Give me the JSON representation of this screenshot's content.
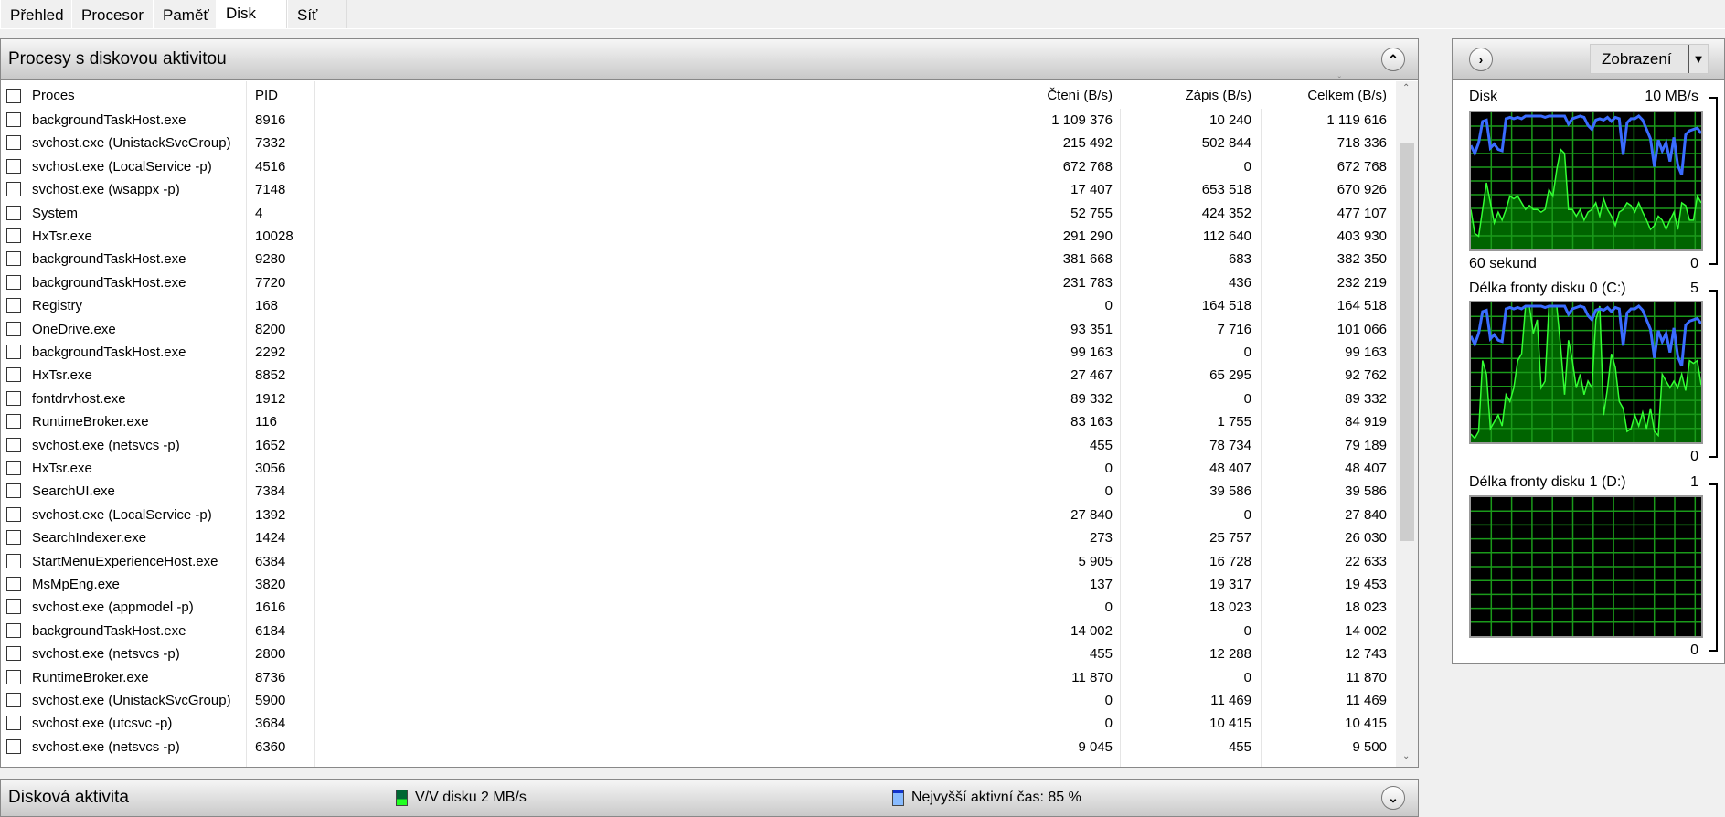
{
  "tabs": [
    "Přehled",
    "Procesor",
    "Paměť",
    "Disk",
    "Síť"
  ],
  "active_tab": "Disk",
  "processes_section": {
    "title": "Procesy s diskovou aktivitou",
    "columns": {
      "name": "Proces",
      "pid": "PID",
      "read": "Čtení (B/s)",
      "write": "Zápis (B/s)",
      "total": "Celkem (B/s)"
    },
    "rows": [
      [
        "backgroundTaskHost.exe",
        "8916",
        "1 109 376",
        "10 240",
        "1 119 616"
      ],
      [
        "svchost.exe (UnistackSvcGroup)",
        "7332",
        "215 492",
        "502 844",
        "718 336"
      ],
      [
        "svchost.exe (LocalService -p)",
        "4516",
        "672 768",
        "0",
        "672 768"
      ],
      [
        "svchost.exe (wsappx -p)",
        "7148",
        "17 407",
        "653 518",
        "670 926"
      ],
      [
        "System",
        "4",
        "52 755",
        "424 352",
        "477 107"
      ],
      [
        "HxTsr.exe",
        "10028",
        "291 290",
        "112 640",
        "403 930"
      ],
      [
        "backgroundTaskHost.exe",
        "9280",
        "381 668",
        "683",
        "382 350"
      ],
      [
        "backgroundTaskHost.exe",
        "7720",
        "231 783",
        "436",
        "232 219"
      ],
      [
        "Registry",
        "168",
        "0",
        "164 518",
        "164 518"
      ],
      [
        "OneDrive.exe",
        "8200",
        "93 351",
        "7 716",
        "101 066"
      ],
      [
        "backgroundTaskHost.exe",
        "2292",
        "99 163",
        "0",
        "99 163"
      ],
      [
        "HxTsr.exe",
        "8852",
        "27 467",
        "65 295",
        "92 762"
      ],
      [
        "fontdrvhost.exe",
        "1912",
        "89 332",
        "0",
        "89 332"
      ],
      [
        "RuntimeBroker.exe",
        "116",
        "83 163",
        "1 755",
        "84 919"
      ],
      [
        "svchost.exe (netsvcs -p)",
        "1652",
        "455",
        "78 734",
        "79 189"
      ],
      [
        "HxTsr.exe",
        "3056",
        "0",
        "48 407",
        "48 407"
      ],
      [
        "SearchUI.exe",
        "7384",
        "0",
        "39 586",
        "39 586"
      ],
      [
        "svchost.exe (LocalService -p)",
        "1392",
        "27 840",
        "0",
        "27 840"
      ],
      [
        "SearchIndexer.exe",
        "1424",
        "273",
        "25 757",
        "26 030"
      ],
      [
        "StartMenuExperienceHost.exe",
        "6384",
        "5 905",
        "16 728",
        "22 633"
      ],
      [
        "MsMpEng.exe",
        "3820",
        "137",
        "19 317",
        "19 453"
      ],
      [
        "svchost.exe (appmodel -p)",
        "1616",
        "0",
        "18 023",
        "18 023"
      ],
      [
        "backgroundTaskHost.exe",
        "6184",
        "14 002",
        "0",
        "14 002"
      ],
      [
        "svchost.exe (netsvcs -p)",
        "2800",
        "455",
        "12 288",
        "12 743"
      ],
      [
        "RuntimeBroker.exe",
        "8736",
        "11 870",
        "0",
        "11 870"
      ],
      [
        "svchost.exe (UnistackSvcGroup)",
        "5900",
        "0",
        "11 469",
        "11 469"
      ],
      [
        "svchost.exe (utcsvc -p)",
        "3684",
        "0",
        "10 415",
        "10 415"
      ],
      [
        "svchost.exe (netsvcs -p)",
        "6360",
        "9 045",
        "455",
        "9 500"
      ]
    ]
  },
  "disk_activity": {
    "title": "Disková aktivita",
    "io_legend": "V/V disku 2 MB/s",
    "active_legend": "Nejvyšší aktivní čas: 85 %"
  },
  "side_panel": {
    "view_button": "Zobrazení",
    "graphs": [
      {
        "title": "Disk",
        "max": "10 MB/s",
        "min": "0",
        "time": "60 sekund",
        "blue": [
          78,
          72,
          80,
          96,
          97,
          76,
          79,
          75,
          74,
          98,
          99,
          98,
          99,
          98,
          100,
          100,
          100,
          100,
          100,
          99,
          100,
          100,
          100,
          100,
          100,
          94,
          98,
          99,
          100,
          99,
          93,
          90,
          97,
          98,
          97,
          99,
          96,
          99,
          98,
          71,
          95,
          98,
          98,
          100,
          97,
          90,
          83,
          62,
          82,
          74,
          80,
          66,
          84,
          63,
          56,
          86,
          89,
          90,
          91,
          87
        ],
        "green": [
          30,
          12,
          10,
          30,
          50,
          35,
          20,
          28,
          22,
          30,
          40,
          38,
          40,
          35,
          30,
          33,
          30,
          30,
          28,
          30,
          45,
          40,
          60,
          75,
          72,
          30,
          30,
          25,
          30,
          22,
          28,
          30,
          35,
          25,
          38,
          30,
          25,
          18,
          28,
          30,
          35,
          33,
          28,
          35,
          28,
          22,
          15,
          18,
          25,
          22,
          15,
          22,
          28,
          15,
          35,
          33,
          22,
          22,
          40,
          35
        ]
      },
      {
        "title": "Délka fronty disku 0 (C:)",
        "max": "5",
        "min": "0",
        "blue": [
          78,
          72,
          80,
          96,
          97,
          76,
          79,
          75,
          74,
          98,
          99,
          98,
          99,
          98,
          100,
          100,
          100,
          100,
          100,
          99,
          100,
          100,
          100,
          100,
          100,
          94,
          98,
          99,
          100,
          99,
          93,
          90,
          97,
          98,
          97,
          99,
          96,
          99,
          98,
          71,
          95,
          98,
          98,
          100,
          97,
          90,
          83,
          62,
          82,
          74,
          80,
          66,
          84,
          63,
          56,
          86,
          89,
          90,
          91,
          87
        ],
        "green": [
          6,
          3,
          8,
          60,
          50,
          10,
          15,
          20,
          12,
          35,
          30,
          40,
          60,
          65,
          100,
          100,
          80,
          90,
          40,
          45,
          100,
          100,
          100,
          70,
          35,
          75,
          60,
          40,
          50,
          35,
          45,
          40,
          90,
          100,
          20,
          40,
          65,
          55,
          30,
          25,
          8,
          10,
          20,
          12,
          22,
          10,
          25,
          8,
          5,
          50,
          45,
          40,
          45,
          40,
          50,
          38,
          60,
          58,
          60,
          42
        ]
      },
      {
        "title": "Délka fronty disku 1 (D:)",
        "max": "1",
        "min": "0",
        "blue": [],
        "green": []
      }
    ]
  }
}
